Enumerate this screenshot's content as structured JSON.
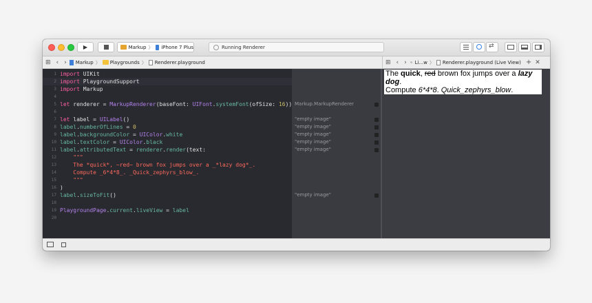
{
  "toolbar": {
    "scheme_project": "Markup",
    "scheme_device": "iPhone 7 Plus",
    "status_text": "Running Renderer"
  },
  "jumpbar": {
    "left": [
      "Markup",
      "Playgrounds",
      "Renderer.playground"
    ],
    "right_first": "Li...w",
    "right_file": "Renderer.playground (Live View)"
  },
  "editor": {
    "lines": [
      {
        "n": "1",
        "html": "<span class=\"kw\">import</span><span class=\"tx\"> UIKit</span>"
      },
      {
        "n": "2",
        "html": "<span class=\"kw\">import</span><span class=\"tx\"> PlaygroundSupport</span>"
      },
      {
        "n": "3",
        "html": "<span class=\"kw\">import</span><span class=\"tx\"> Markup</span>"
      },
      {
        "n": "4",
        "html": ""
      },
      {
        "n": "5",
        "html": "<span class=\"kw\">let</span><span class=\"tx\"> renderer = </span><span class=\"ty\">MarkupRenderer</span><span class=\"tx\">(baseFont: </span><span class=\"ty\">UIFont</span><span class=\"tx\">.</span><span class=\"fn\">systemFont</span><span class=\"tx\">(ofSize: </span><span class=\"nu\">16</span><span class=\"tx\">))</span>"
      },
      {
        "n": "6",
        "html": ""
      },
      {
        "n": "7",
        "html": "<span class=\"kw\">let</span><span class=\"tx\"> label = </span><span class=\"ty\">UILabel</span><span class=\"tx\">()</span>"
      },
      {
        "n": "8",
        "html": "<span class=\"fn\">label</span><span class=\"tx\">.</span><span class=\"fn\">numberOfLines</span><span class=\"tx\"> = </span><span class=\"nu\">0</span>"
      },
      {
        "n": "9",
        "html": "<span class=\"fn\">label</span><span class=\"tx\">.</span><span class=\"fn\">backgroundColor</span><span class=\"tx\"> = </span><span class=\"ty\">UIColor</span><span class=\"tx\">.</span><span class=\"fn\">white</span>"
      },
      {
        "n": "10",
        "html": "<span class=\"fn\">label</span><span class=\"tx\">.</span><span class=\"fn\">textColor</span><span class=\"tx\"> = </span><span class=\"ty\">UIColor</span><span class=\"tx\">.</span><span class=\"fn\">black</span>"
      },
      {
        "n": "11",
        "html": "<span class=\"fn\">label</span><span class=\"tx\">.</span><span class=\"fn\">attributedText</span><span class=\"tx\"> = </span><span class=\"fn\">renderer</span><span class=\"tx\">.</span><span class=\"fn\">render</span><span class=\"tx\">(text:</span>"
      },
      {
        "n": "12",
        "html": "<span class=\"st\">    \"\"\"</span>"
      },
      {
        "n": "13",
        "html": "<span class=\"st\">    The *quick*, ~red~ brown fox jumps over a _*lazy dog*_.</span>"
      },
      {
        "n": "14",
        "html": "<span class=\"st\">    Compute _6*4*8_. _Quick_zephyrs_blow_.</span>"
      },
      {
        "n": "15",
        "html": "<span class=\"st\">    \"\"\"</span>"
      },
      {
        "n": "16",
        "html": "<span class=\"tx\">)</span>"
      },
      {
        "n": "17",
        "html": "<span class=\"fn\">label</span><span class=\"tx\">.</span><span class=\"fn\">sizeToFit</span><span class=\"tx\">()</span>"
      },
      {
        "n": "18",
        "html": ""
      },
      {
        "n": "19",
        "html": "<span class=\"ty\">PlaygroundPage</span><span class=\"tx\">.</span><span class=\"fn\">current</span><span class=\"tx\">.</span><span class=\"fn\">liveView</span><span class=\"tx\"> = </span><span class=\"fn\">label</span>"
      },
      {
        "n": "20",
        "html": ""
      }
    ],
    "current_line": "2"
  },
  "results": [
    {
      "line": "5",
      "text": "Markup.MarkupRenderer"
    },
    {
      "line": "7",
      "text": "\"empty image\""
    },
    {
      "line": "8",
      "text": "\"empty image\""
    },
    {
      "line": "9",
      "text": "\"empty image\""
    },
    {
      "line": "10",
      "text": "\"empty image\""
    },
    {
      "line": "11",
      "text": "\"empty image\""
    },
    {
      "line": "17",
      "text": "\"empty image\""
    }
  ],
  "liveview": {
    "line1_pre": "The ",
    "line1_bold": "quick",
    "line1_comma": ", ",
    "line1_strike": "red",
    "line1_mid": " brown fox jumps over a ",
    "line1_bolditalic": "lazy dog",
    "line1_end": ".",
    "line2_pre": "Compute ",
    "line2_italic1": "6*4*8",
    "line2_mid": ". ",
    "line2_italic2": "Quick_zephyrs_blow",
    "line2_end": "."
  },
  "colors": {
    "editor_bg": "#292a2f",
    "keyword": "#fc5fa3",
    "type": "#b281eb",
    "function": "#67b7a4",
    "string": "#fc6a5d",
    "number": "#d0bf69"
  }
}
